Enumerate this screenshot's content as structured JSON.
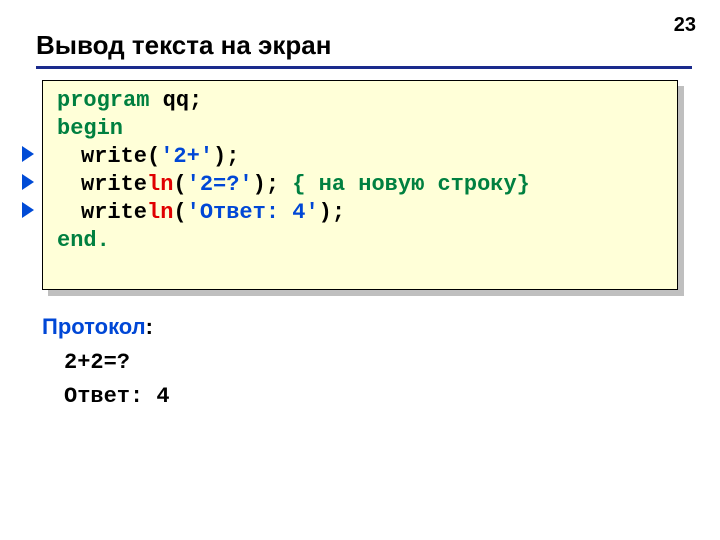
{
  "page_number": "23",
  "title": "Вывод текста на экран",
  "code": {
    "l1": {
      "kw_prog": "program ",
      "name": "qq",
      "semi": ";"
    },
    "l2": {
      "kw_begin": "begin"
    },
    "l3": {
      "fn": "write(",
      "arg": "'2+'",
      "close": ");"
    },
    "l4": {
      "fn_pre": "write",
      "fn_ln": "ln",
      "open": "(",
      "arg": "'2=?'",
      "post_arg": "); ",
      "comment": "{ на новую строку}"
    },
    "l5": {
      "fn_pre": "write",
      "fn_ln": "ln",
      "open": "(",
      "arg": "'Ответ: 4'",
      "close": ");"
    },
    "l6": {
      "kw_end": "end."
    }
  },
  "protocol": {
    "label": "Протокол",
    "colon": ":",
    "out1": "2+2=?",
    "out2": "Ответ: 4"
  }
}
